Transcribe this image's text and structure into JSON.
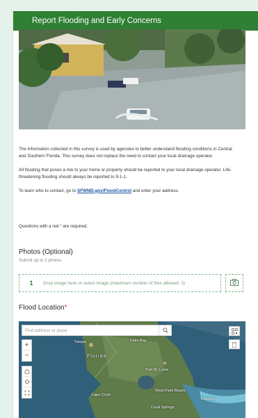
{
  "header": {
    "title": "Report Flooding and Early Concerns"
  },
  "intro": {
    "p1": "The information collected in this survey is used by agencies to better understand flooding conditions in Central and Southern Florida. This survey does not replace the need to contact your local drainage operator.",
    "p2": "All flooding that poses a risk to your home or property should be reported to your local drainage operator. Life-threatening flooding should always be reported to 9-1-1.",
    "p3_before": "To learn who to contact, go to ",
    "p3_link": "SFWMD.gov/FloodControl",
    "p3_after": " and enter your address."
  },
  "required_note": {
    "text": "Questions with a red ",
    "star": "*",
    "after": " are required."
  },
  "photos": {
    "title": "Photos (Optional)",
    "subtitle": "Submit up to 3 photos.",
    "count": "1",
    "drop_text": "Drop image here or select image (maximum number of files allowed: 3)"
  },
  "location": {
    "title": "Flood Location",
    "star": "*",
    "search_placeholder": "Find address or place",
    "cities": {
      "tampa": "Tampa",
      "palm_bay": "Palm Bay",
      "florida": "Florida",
      "port_st_lucie": "Port St. Lucie",
      "cape_coral": "Cape Coral",
      "west_palm": "West Palm Beach",
      "freeport": "Freeport",
      "coral_springs": "Coral Springs"
    }
  },
  "colors": {
    "header_bg": "#2f7f34",
    "page_bg": "#e5f2ec",
    "required": "#c0392b",
    "link": "#1a56a0"
  },
  "icons": [
    "search-icon",
    "camera-icon",
    "zoom-in-icon",
    "zoom-out-icon",
    "home-icon",
    "locate-icon",
    "fullscreen-icon",
    "qr-code-icon",
    "delete-icon"
  ]
}
